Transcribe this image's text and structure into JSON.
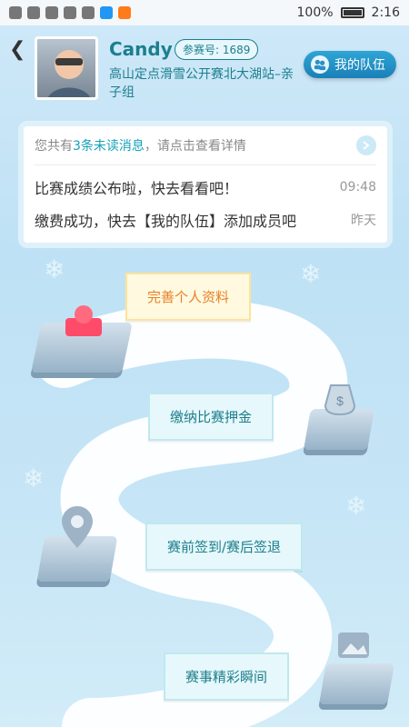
{
  "status": {
    "battery": "100%",
    "time": "2:16"
  },
  "profile": {
    "name": "Candy",
    "badge": "参赛号: 1689",
    "event": "高山定点滑雪公开赛北大湖站–亲子组"
  },
  "team_button": "我的队伍",
  "messages": {
    "summary_prefix": "您共有",
    "summary_count": "3条未读消息",
    "summary_suffix": "，请点击查看详情",
    "items": [
      {
        "text": "比赛成绩公布啦，快去看看吧！",
        "time": "09:48"
      },
      {
        "text": "缴费成功，快去【我的队伍】添加成员吧",
        "time": "昨天"
      }
    ]
  },
  "steps": [
    {
      "label": "完善个人资料",
      "icon": "avatar-icon"
    },
    {
      "label": "缴纳比赛押金",
      "icon": "money-bag-icon"
    },
    {
      "label": "赛前签到/赛后签退",
      "icon": "location-pin-icon"
    },
    {
      "label": "赛事精彩瞬间",
      "icon": "gallery-icon"
    }
  ]
}
